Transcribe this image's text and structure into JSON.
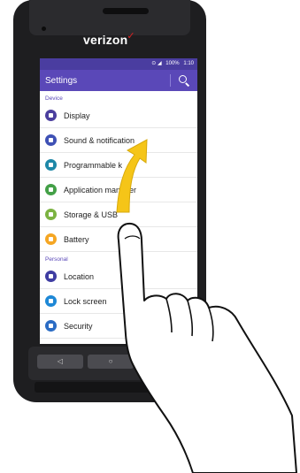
{
  "device": {
    "brand": "verizon",
    "nav_back": "◁",
    "nav_home": "○"
  },
  "status_bar": {
    "signal": "⊙ ◢",
    "battery": "100%",
    "time": "1:10"
  },
  "app_bar": {
    "title": "Settings",
    "search_icon": "search-icon"
  },
  "sections": [
    {
      "header": "Device",
      "items": [
        {
          "label": "Display",
          "icon": "display-icon",
          "color": "#4b3f9e"
        },
        {
          "label": "Sound & notification",
          "icon": "sound-icon",
          "color": "#3f51b5"
        },
        {
          "label": "Programmable k",
          "icon": "programmable-key-icon",
          "color": "#1e88a8"
        },
        {
          "label": "Application manager",
          "icon": "application-manager-icon",
          "color": "#43a047"
        },
        {
          "label": "Storage & USB",
          "icon": "storage-icon",
          "color": "#7cb342"
        },
        {
          "label": "Battery",
          "icon": "battery-icon",
          "color": "#f5a623"
        }
      ]
    },
    {
      "header": "Personal",
      "items": [
        {
          "label": "Location",
          "icon": "location-icon",
          "color": "#3f3da2"
        },
        {
          "label": "Lock screen",
          "icon": "lock-screen-icon",
          "color": "#1e88d6"
        },
        {
          "label": "Security",
          "icon": "security-icon",
          "color": "#2b6cc4"
        }
      ]
    }
  ],
  "gesture": {
    "arrow_color": "#f5c518",
    "hand_icon": "pointing-hand-icon",
    "direction": "swipe-up"
  }
}
